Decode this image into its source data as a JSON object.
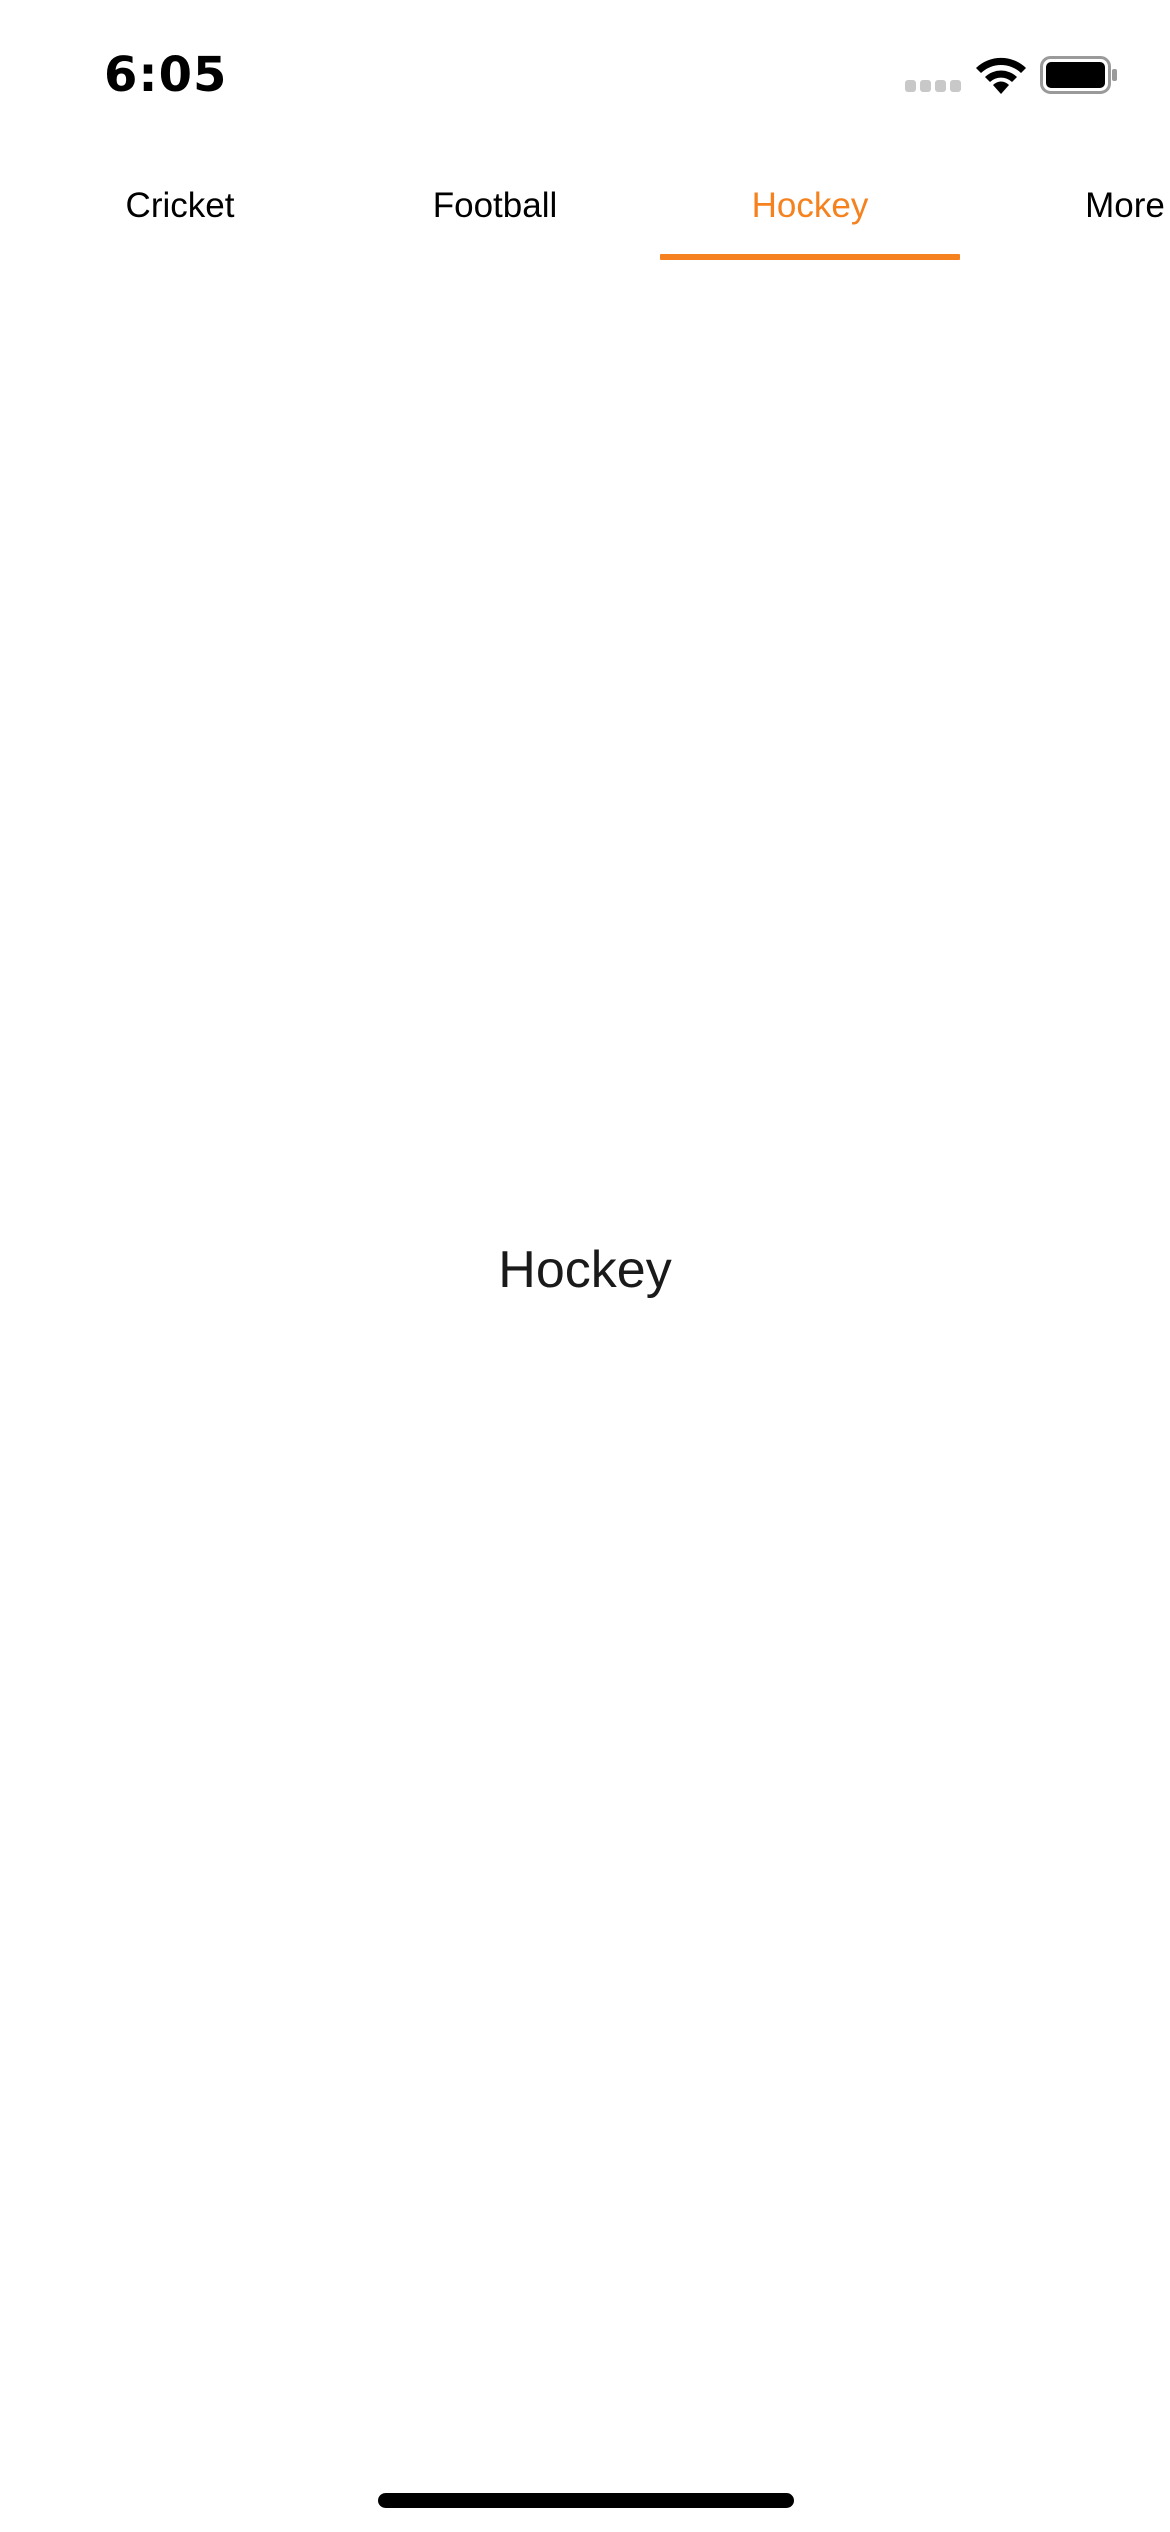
{
  "status_bar": {
    "time": "6:05",
    "icons": [
      "signal-icon",
      "wifi-icon",
      "battery-icon"
    ]
  },
  "tabs": [
    {
      "label": "Cricket",
      "active": false
    },
    {
      "label": "Football",
      "active": false
    },
    {
      "label": "Hockey",
      "active": true
    },
    {
      "label": "More",
      "active": false
    }
  ],
  "content": {
    "title": "Hockey"
  },
  "colors": {
    "accent": "#F5821F",
    "text": "#000000",
    "background": "#FFFFFF"
  }
}
